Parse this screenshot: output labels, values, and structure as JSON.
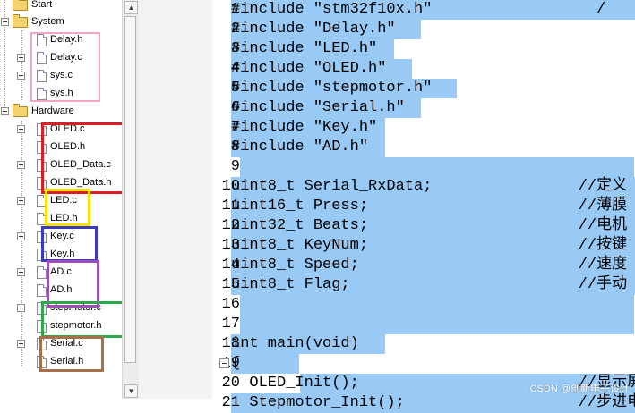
{
  "project_tree": {
    "start_label": "Start",
    "system": {
      "label": "System",
      "files": [
        "Delay.h",
        "Delay.c",
        "sys.c",
        "sys.h"
      ]
    },
    "hardware": {
      "label": "Hardware",
      "files": [
        "OLED.c",
        "OLED.h",
        "OLED_Data.c",
        "OLED_Data.h",
        "LED.c",
        "LED.h",
        "Key.c",
        "Key.h",
        "AD.c",
        "AD.h",
        "stepmotor.c",
        "stepmotor.h",
        "Serial.c",
        "Serial.h"
      ]
    }
  },
  "highlight_colors": {
    "system": "#f4a6c7",
    "oled": "#e01d24",
    "led": "#f5e400",
    "key": "#3a3ac2",
    "ad": "#9d4fb2",
    "stepmotor": "#2fa84a",
    "serial": "#a8704a"
  },
  "editor": {
    "selection_color": "#99c9f5",
    "lines": [
      {
        "n": "1",
        "text": "#include \"stm32f10x.h\"                  /"
      },
      {
        "n": "2",
        "text": "#include \"Delay.h\""
      },
      {
        "n": "3",
        "text": "#include \"LED.h\""
      },
      {
        "n": "4",
        "text": "#include \"OLED.h\""
      },
      {
        "n": "5",
        "text": "#include \"stepmotor.h\""
      },
      {
        "n": "6",
        "text": "#include \"Serial.h\""
      },
      {
        "n": "7",
        "text": "#include \"Key.h\""
      },
      {
        "n": "8",
        "text": "#include \"AD.h\""
      },
      {
        "n": "9",
        "text": ""
      },
      {
        "n": "10",
        "text": "uint8_t Serial_RxData;                //定义"
      },
      {
        "n": "11",
        "text": "uint16_t Press;                       //薄膜"
      },
      {
        "n": "12",
        "text": "uint32_t Beats;                       //电机"
      },
      {
        "n": "13",
        "text": "uint8_t KeyNum;                       //按键"
      },
      {
        "n": "14",
        "text": "uint8_t Speed;                        //速度"
      },
      {
        "n": "15",
        "text": "uint8_t Flag;                         //手动"
      },
      {
        "n": "16",
        "text": ""
      },
      {
        "n": "17",
        "text": ""
      },
      {
        "n": "18",
        "text": "int main(void)"
      },
      {
        "n": "19",
        "text": "{"
      },
      {
        "n": "20",
        "text": "  OLED_Init();                        //显示屏初"
      },
      {
        "n": "21",
        "text": "  Stepmotor_Init();                   //步进电机"
      }
    ]
  },
  "watermark": "CSDN @创新电子设计"
}
